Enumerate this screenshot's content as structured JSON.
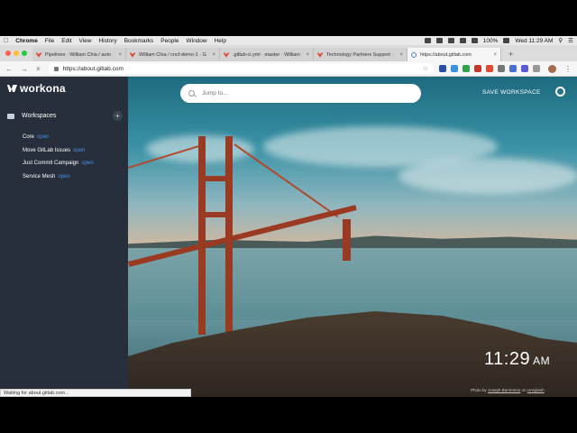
{
  "menubar": {
    "app": "Chrome",
    "items": [
      "File",
      "Edit",
      "View",
      "History",
      "Bookmarks",
      "People",
      "Window",
      "Help"
    ],
    "battery": "100%",
    "clock": "Wed 11:29 AM"
  },
  "tabs": [
    {
      "label": "Pipelines · William Chia / auto",
      "active": false
    },
    {
      "label": "William Chia / cncf-demo-1 · G",
      "active": false
    },
    {
      "label": ".gitlab-ci.yml · master · William",
      "active": false
    },
    {
      "label": "Technology Partners Support ·",
      "active": false
    },
    {
      "label": "https://about.gitlab.com",
      "active": true
    }
  ],
  "omnibox": {
    "url": "https://about.gitlab.com"
  },
  "sidebar": {
    "brand": "workona",
    "section_title": "Workspaces",
    "items": [
      {
        "label": "Core",
        "status": "open"
      },
      {
        "label": "Move GitLab Issues",
        "status": "open"
      },
      {
        "label": "Just Commit Campaign",
        "status": "open"
      },
      {
        "label": "Service Mesh",
        "status": "open"
      }
    ]
  },
  "main": {
    "search_placeholder": "Jump to...",
    "save_label": "SAVE WORKSPACE",
    "time": "11:29",
    "ampm": "AM",
    "credit_prefix": "Photo by",
    "credit_author": "Joseph Barrientos",
    "credit_on": "on",
    "credit_site": "Unsplash"
  },
  "status_text": "Waiting for about.gitlab.com...",
  "colors": {
    "sidebar_bg": "#262f3b",
    "accent_link": "#4a8fe0",
    "gitlab_orange": "#e2492f"
  }
}
